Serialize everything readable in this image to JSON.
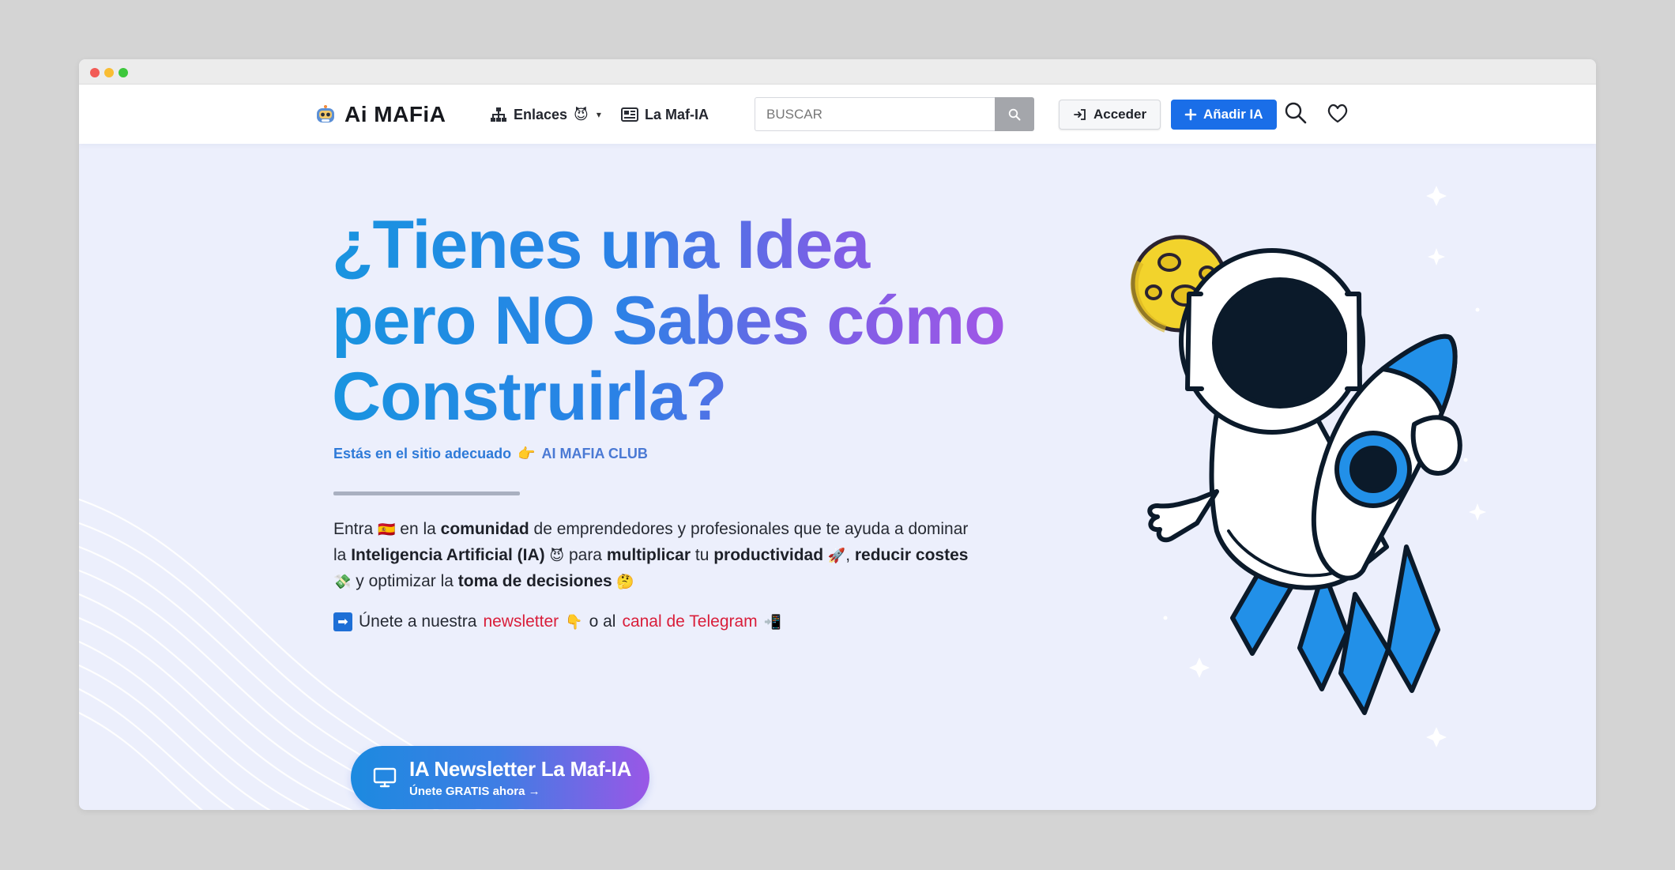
{
  "nav": {
    "brand": "Ai MAFiA",
    "enlaces_label": "Enlaces",
    "enlaces_emoji": "😈",
    "maf_label": "La Maf-IA",
    "search_placeholder": "BUSCAR",
    "acceder_label": "Acceder",
    "anadir_label": "Añadir IA"
  },
  "hero": {
    "headline_line1": "¿Tienes una Idea",
    "headline_line2": "pero NO Sabes cómo",
    "headline_line3": "Construirla?",
    "subtitle_prefix": "Estás en el sitio adecuado",
    "subtitle_emoji": "👉",
    "subtitle_club": "AI MAFIA CLUB",
    "para": {
      "t1": "Entra ",
      "e1": "🇪🇸",
      "t2": " en la ",
      "b1": "comunidad",
      "t3": " de emprendedores y profesionales que te ayuda a dominar la ",
      "b2": "Inteligencia Artificial (IA)",
      "e2": " 😈",
      "t4": " para ",
      "b3": "multiplicar",
      "t5": " tu ",
      "b4": "productividad",
      "e3": " 🚀",
      "t6": ", ",
      "b5": "reducir costes",
      "e4": " 💸",
      "t7": " y optimizar la ",
      "b6": "toma de decisiones",
      "e5": " 🤔"
    },
    "join": {
      "arrow": "➡",
      "t1": "Únete a nuestra ",
      "newsletter": "newsletter",
      "e1": "👇",
      "t2": " o al ",
      "telegram": "canal de Telegram",
      "e2": "📲"
    },
    "cta_title": "IA Newsletter La Maf-IA",
    "cta_sub": "Únete GRATIS ahora →"
  },
  "colors": {
    "brand_blue": "#1a6ee8",
    "hero_bg": "#eceffc",
    "link_red": "#d91e3a",
    "gradient_start": "#1994e0",
    "gradient_end": "#a855e6"
  },
  "icons": [
    "robot-logo-icon",
    "sitemap-icon",
    "newspaper-icon",
    "search-icon",
    "login-icon",
    "plus-icon",
    "heart-icon",
    "monitor-icon",
    "moon-icon",
    "astronaut-rocket-illustration"
  ]
}
